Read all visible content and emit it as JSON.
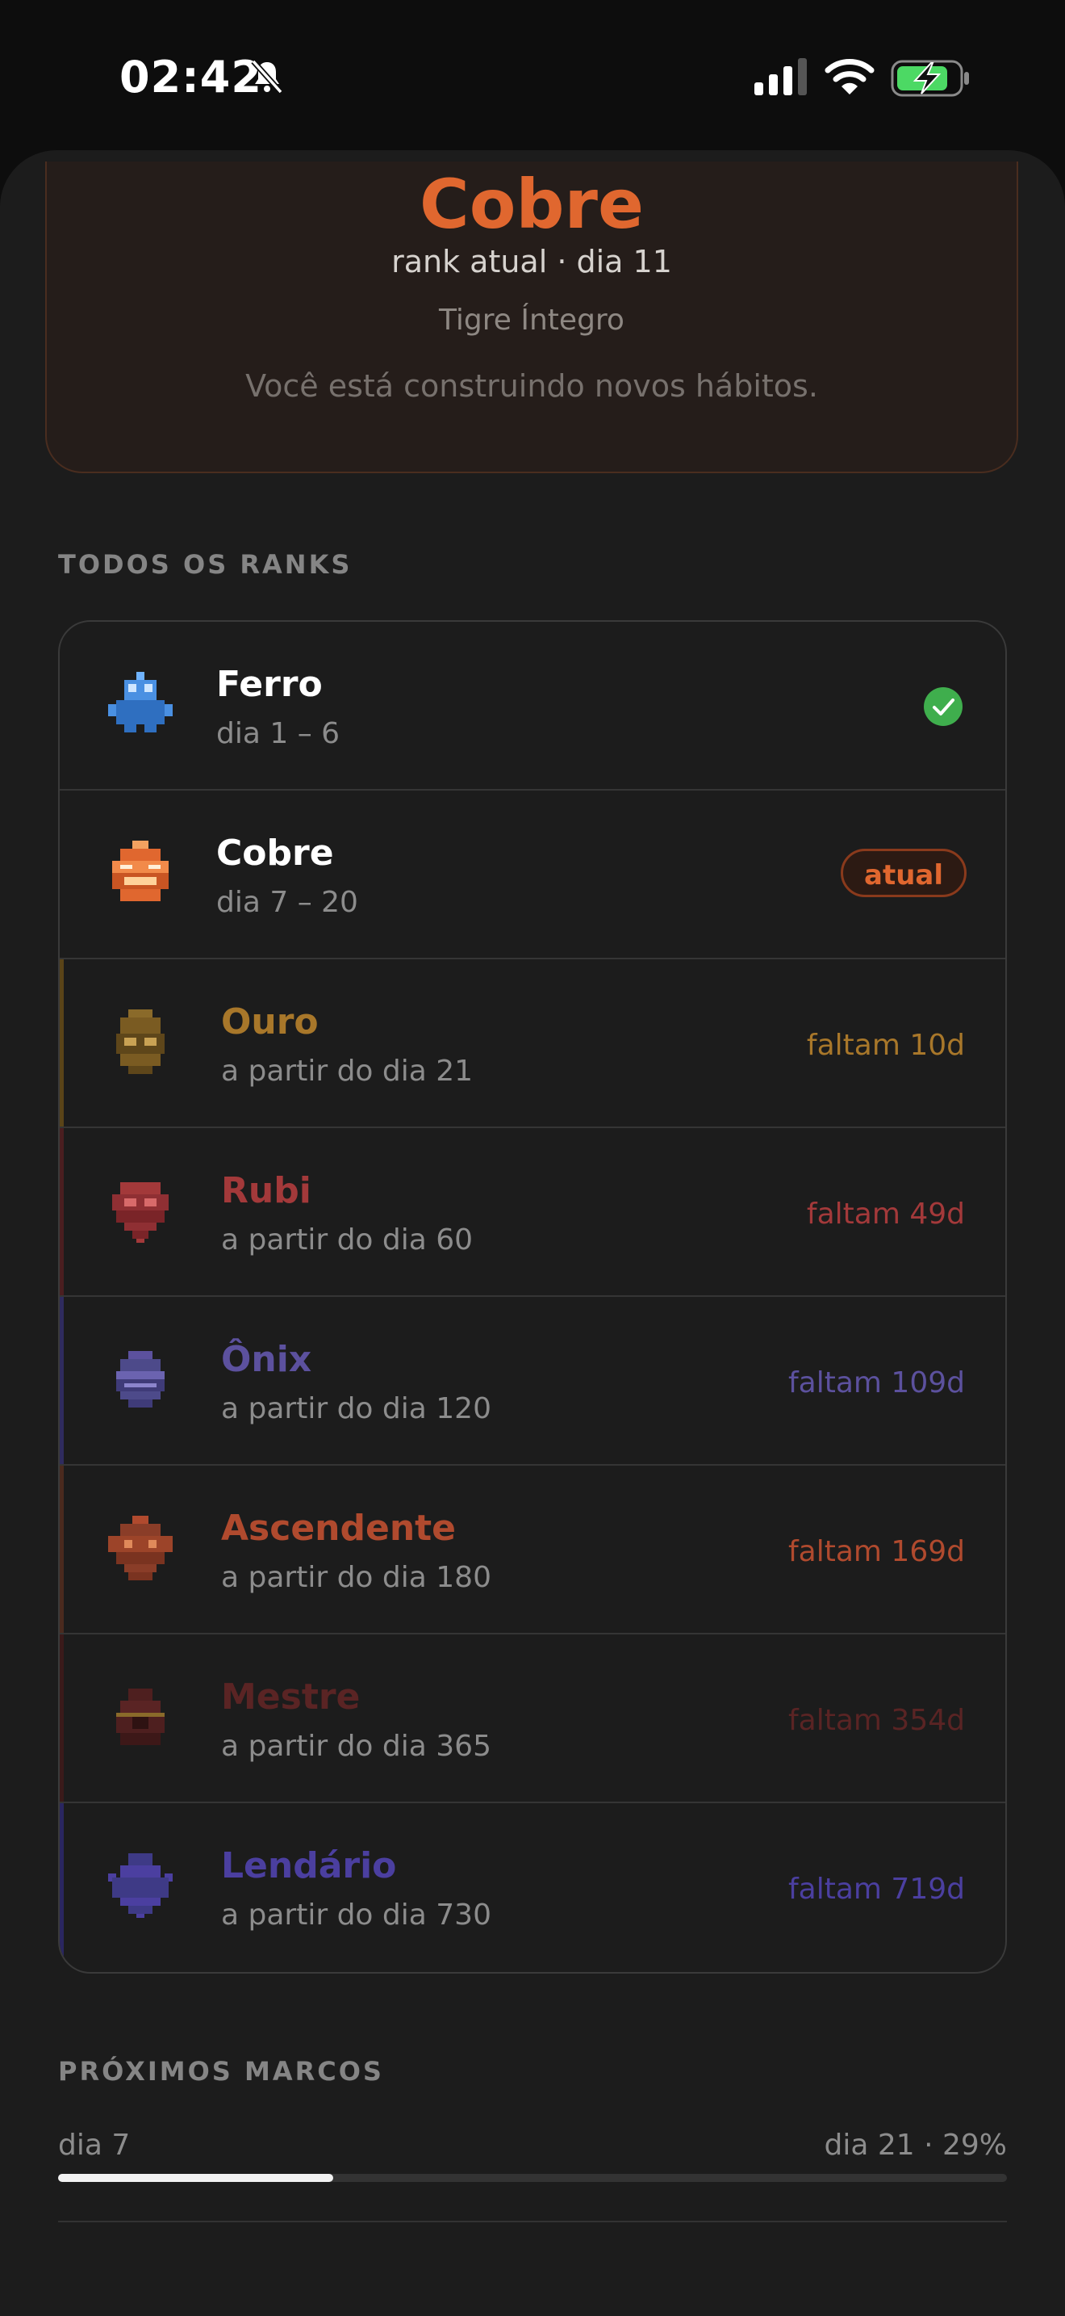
{
  "status_bar": {
    "time": "02:42",
    "icons": [
      "bell-muted-icon",
      "signal-icon",
      "wifi-icon",
      "battery-charging-icon"
    ]
  },
  "hero": {
    "title": "Cobre",
    "subtitle": "rank atual · dia 11",
    "name": "Tigre Íntegro",
    "description": "Você está construindo novos hábitos.",
    "color": "#e0672f"
  },
  "ranks_section": {
    "label": "TODOS OS RANKS",
    "items": [
      {
        "name": "Ferro",
        "range": "dia 1 – 6",
        "status": "done",
        "color": "#ffffff",
        "icon_color": "#4a90e2"
      },
      {
        "name": "Cobre",
        "range": "dia 7 – 20",
        "status": "atual",
        "status_label": "atual",
        "color": "#ffffff",
        "icon_color": "#e0672f"
      },
      {
        "name": "Ouro",
        "range": "a partir do dia 21",
        "status": "locked",
        "remaining": "faltam 10d",
        "color": "#a8772a",
        "icon_color": "#8a6a2a"
      },
      {
        "name": "Rubi",
        "range": "a partir do dia 60",
        "status": "locked",
        "remaining": "faltam 49d",
        "color": "#a3393a",
        "icon_color": "#8f2f33"
      },
      {
        "name": "Ônix",
        "range": "a partir do dia 120",
        "status": "locked",
        "remaining": "faltam 109d",
        "color": "#5c519e",
        "icon_color": "#4d4a8a"
      },
      {
        "name": "Ascendente",
        "range": "a partir do dia 180",
        "status": "locked",
        "remaining": "faltam 169d",
        "color": "#b04a2e",
        "icon_color": "#8a3d28"
      },
      {
        "name": "Mestre",
        "range": "a partir do dia 365",
        "status": "locked",
        "remaining": "faltam 354d",
        "color": "#5a2424",
        "icon_color": "#4e1f1f"
      },
      {
        "name": "Lendário",
        "range": "a partir do dia 730",
        "status": "locked",
        "remaining": "faltam 719d",
        "color": "#4b3fa0",
        "icon_color": "#3e3a86"
      }
    ]
  },
  "milestones": {
    "label": "PRÓXIMOS MARCOS",
    "start": "dia 7",
    "end": "dia 21 · 29%",
    "progress": 0.29
  }
}
